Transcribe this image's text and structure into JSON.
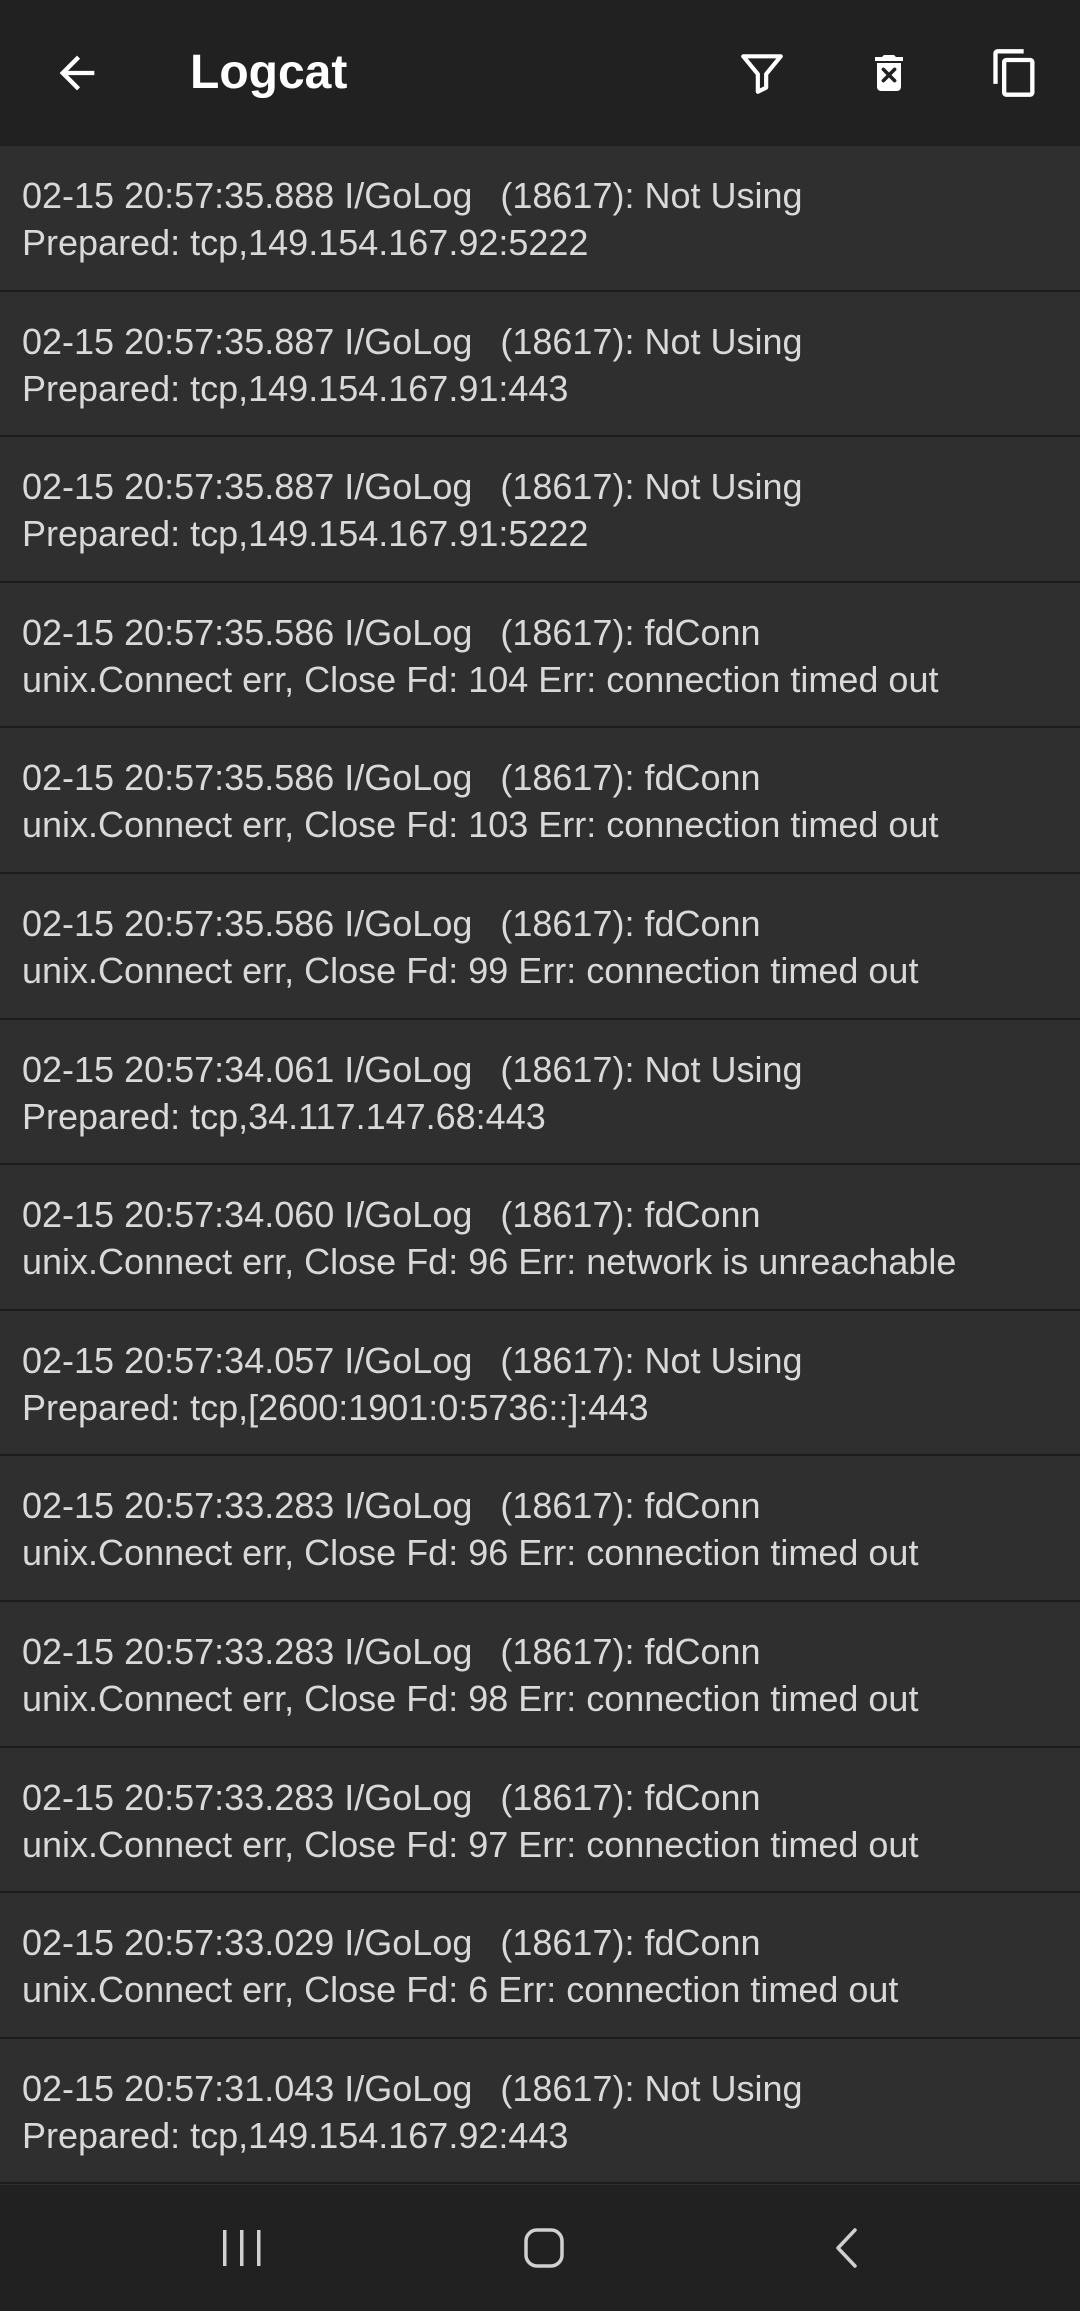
{
  "appbar": {
    "title": "Logcat",
    "icons": {
      "back": "arrow-back-icon",
      "filter": "filter-icon",
      "delete": "delete-icon",
      "copy": "copy-icon"
    }
  },
  "logs": [
    {
      "prefix": "02-15 20:57:35.888 I/GoLog",
      "msg": "(18617): Not Using",
      "detail": "Prepared: tcp,149.154.167.92:5222"
    },
    {
      "prefix": "02-15 20:57:35.887 I/GoLog",
      "msg": "(18617): Not Using",
      "detail": "Prepared: tcp,149.154.167.91:443"
    },
    {
      "prefix": "02-15 20:57:35.887 I/GoLog",
      "msg": "(18617): Not Using",
      "detail": "Prepared: tcp,149.154.167.91:5222"
    },
    {
      "prefix": "02-15 20:57:35.586 I/GoLog",
      "msg": "(18617): fdConn",
      "detail": "unix.Connect err, Close Fd: 104 Err: connection timed out"
    },
    {
      "prefix": "02-15 20:57:35.586 I/GoLog",
      "msg": "(18617): fdConn",
      "detail": "unix.Connect err, Close Fd: 103 Err: connection timed out"
    },
    {
      "prefix": "02-15 20:57:35.586 I/GoLog",
      "msg": "(18617): fdConn",
      "detail": "unix.Connect err, Close Fd: 99 Err: connection timed out"
    },
    {
      "prefix": "02-15 20:57:34.061 I/GoLog",
      "msg": "(18617): Not Using",
      "detail": "Prepared: tcp,34.117.147.68:443"
    },
    {
      "prefix": "02-15 20:57:34.060 I/GoLog",
      "msg": "(18617): fdConn",
      "detail": "unix.Connect err, Close Fd: 96 Err: network is unreachable"
    },
    {
      "prefix": "02-15 20:57:34.057 I/GoLog",
      "msg": "(18617): Not Using",
      "detail": "Prepared: tcp,[2600:1901:0:5736::]:443"
    },
    {
      "prefix": "02-15 20:57:33.283 I/GoLog",
      "msg": "(18617): fdConn",
      "detail": "unix.Connect err, Close Fd: 96 Err: connection timed out"
    },
    {
      "prefix": "02-15 20:57:33.283 I/GoLog",
      "msg": "(18617): fdConn",
      "detail": "unix.Connect err, Close Fd: 98 Err: connection timed out"
    },
    {
      "prefix": "02-15 20:57:33.283 I/GoLog",
      "msg": "(18617): fdConn",
      "detail": "unix.Connect err, Close Fd: 97 Err: connection timed out"
    },
    {
      "prefix": "02-15 20:57:33.029 I/GoLog",
      "msg": "(18617): fdConn",
      "detail": "unix.Connect err, Close Fd: 6 Err: connection timed out"
    },
    {
      "prefix": "02-15 20:57:31.043 I/GoLog",
      "msg": "(18617): Not Using",
      "detail": "Prepared: tcp,149.154.167.92:443"
    }
  ],
  "navbar": {
    "icons": {
      "recents": "recents-icon",
      "home": "home-icon",
      "back": "nav-back-icon"
    }
  },
  "colors": {
    "appbar_bg": "#212121",
    "list_bg": "#2f2f2f",
    "divider": "#1c1c1c",
    "text": "#d9d9d9",
    "title": "#ffffff"
  }
}
